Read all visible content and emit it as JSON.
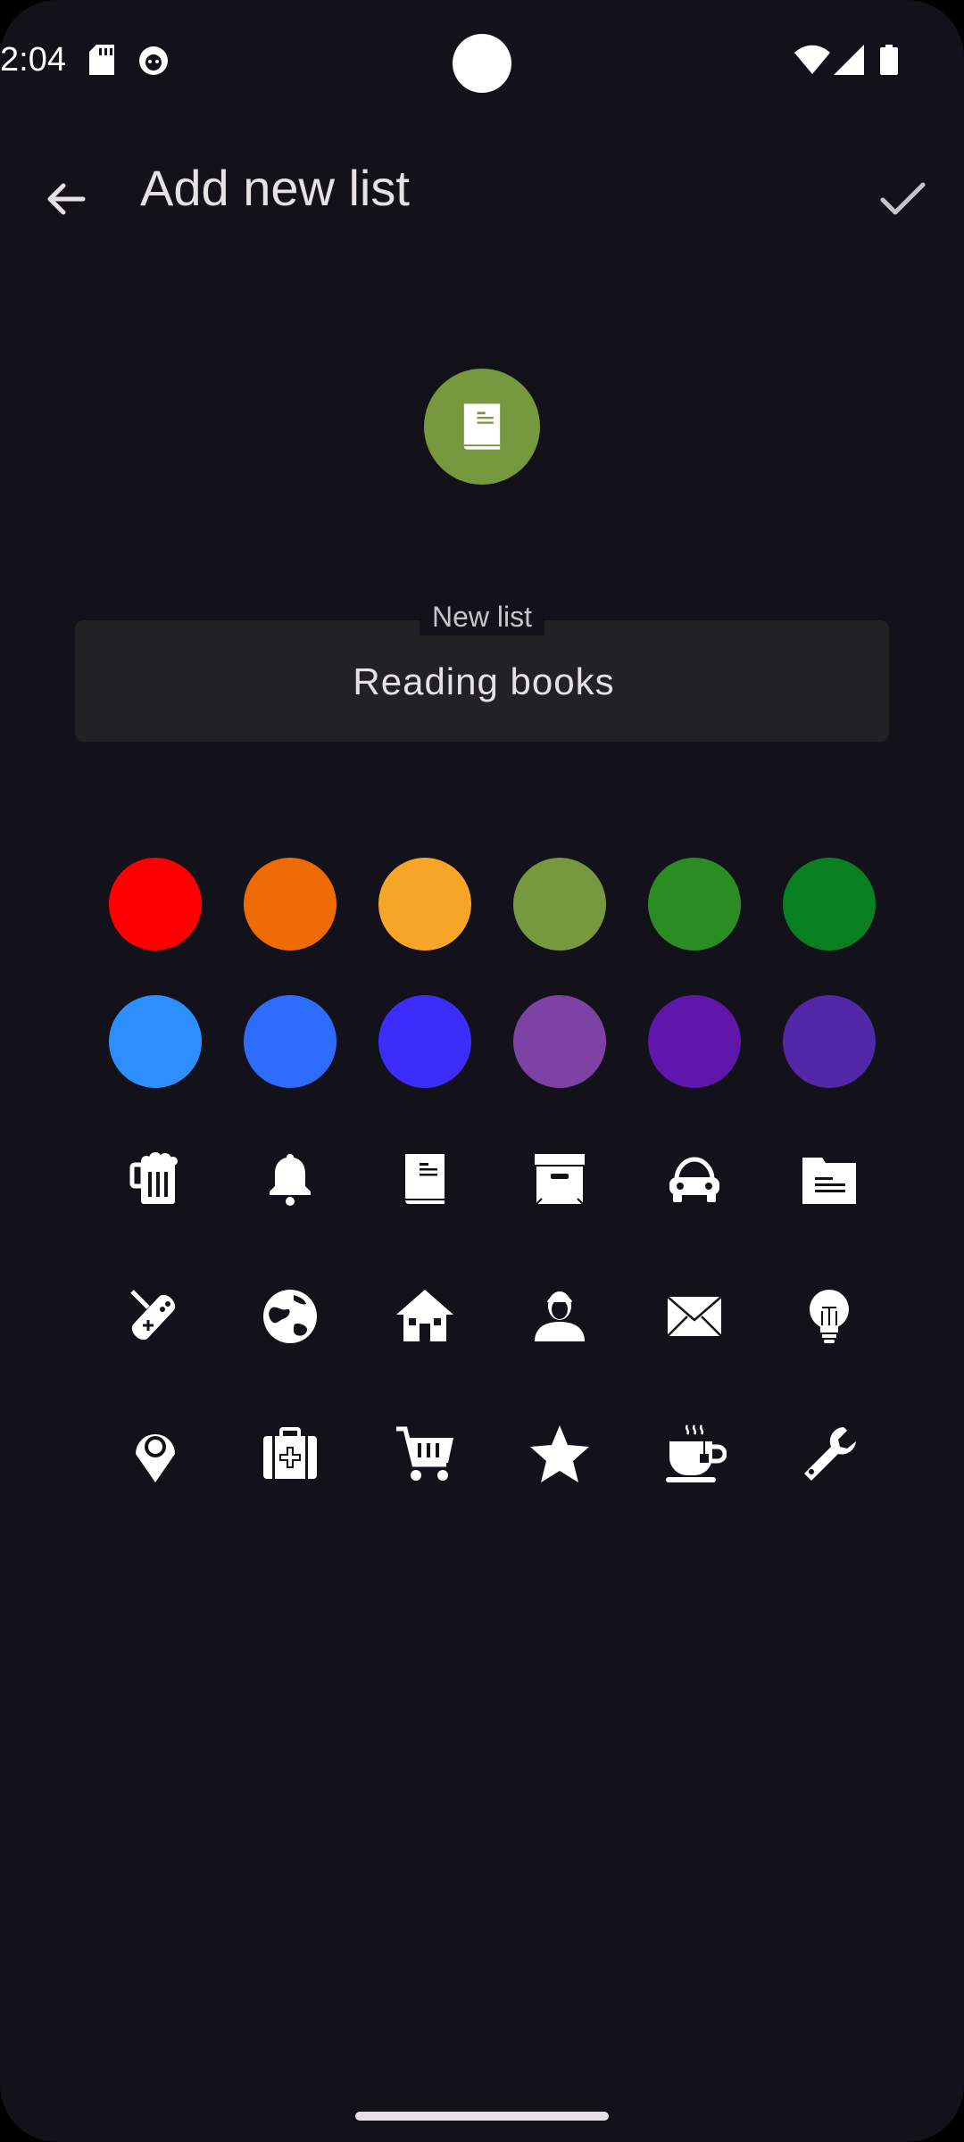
{
  "status_bar": {
    "time": "2:04"
  },
  "app_bar": {
    "title": "Add new list"
  },
  "preview": {
    "color": "#76983f",
    "icon": "book-icon"
  },
  "name_field": {
    "label": "New list",
    "value": "Reading books"
  },
  "colors": [
    [
      "#fe0000",
      "#ee6b03",
      "#f7a527",
      "#76983f",
      "#2a8c22",
      "#087f21"
    ],
    [
      "#2d8efe",
      "#2e6cfe",
      "#3c2dfd",
      "#7e42a5",
      "#5e17aa",
      "#5227a8"
    ]
  ],
  "icons": [
    [
      "beer-icon",
      "bell-icon",
      "book-icon",
      "archive-icon",
      "car-icon",
      "folder-icon"
    ],
    [
      "gamepad-icon",
      "globe-icon",
      "home-icon",
      "person-icon",
      "mail-icon",
      "lightbulb-icon"
    ],
    [
      "location-pin-icon",
      "medical-kit-icon",
      "shopping-cart-icon",
      "star-icon",
      "coffee-cup-icon",
      "wrench-icon"
    ]
  ]
}
